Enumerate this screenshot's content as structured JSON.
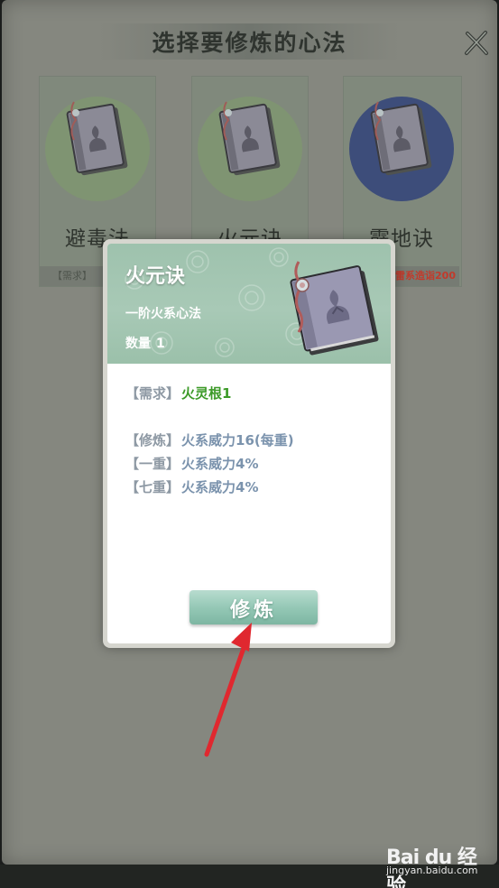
{
  "title": "选择要修炼的心法",
  "cards": [
    {
      "name": "避毒法",
      "requirement": "【需求】",
      "req_red": false,
      "theme": "green"
    },
    {
      "name": "火元诀",
      "requirement": "",
      "req_red": false,
      "theme": "green"
    },
    {
      "name": "霹地诀",
      "requirement": "雷系造诣200",
      "req_red": true,
      "theme": "blue"
    }
  ],
  "modal": {
    "name": "火元诀",
    "type": "一阶火系心法",
    "count_label": "数量",
    "count_value": "1",
    "requirement": {
      "label": "【需求】",
      "value": "火灵根1"
    },
    "stats": [
      {
        "label": "【修炼】",
        "value": "火系威力16(每重)"
      },
      {
        "label": "【一重】",
        "value": "火系威力4%"
      },
      {
        "label": "【七重】",
        "value": "火系威力4%"
      }
    ],
    "train_button": "修炼"
  },
  "watermark": {
    "brand": "Bai du 经验",
    "url": "jingyan.baidu.com"
  },
  "colors": {
    "accent": "#9ec2ad",
    "arrow": "#e0282f",
    "requirement_green": "#3c9a28",
    "stat_blue": "#7b93ad"
  },
  "icons": [
    "close-icon",
    "book-icon",
    "arrow-annotation"
  ]
}
